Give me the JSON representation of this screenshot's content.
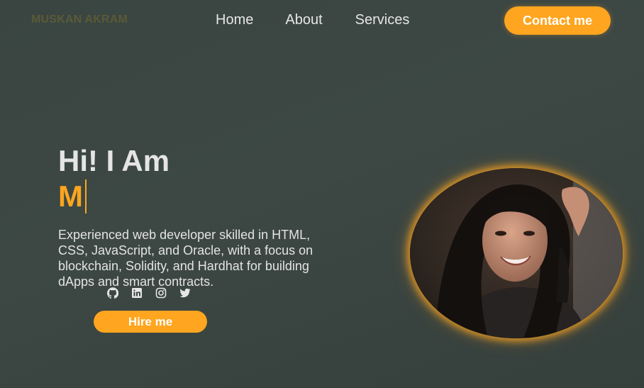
{
  "header": {
    "logo": "MUSKAN AKRAM",
    "nav": [
      {
        "label": "Home"
      },
      {
        "label": "About"
      },
      {
        "label": "Services"
      }
    ],
    "contact_label": "Contact me"
  },
  "hero": {
    "greeting": "Hi! I Am",
    "typed_text": "M",
    "description": "Experienced web developer skilled in HTML, CSS, JavaScript, and Oracle, with a focus on blockchain, Solidity, and Hardhat for building dApps and smart contracts.",
    "socials": [
      {
        "icon": "github-icon"
      },
      {
        "icon": "linkedin-icon"
      },
      {
        "icon": "instagram-icon"
      },
      {
        "icon": "twitter-icon"
      }
    ],
    "hire_label": "Hire me"
  },
  "colors": {
    "accent": "#ffa51f",
    "background": "#3b4642",
    "text": "#e5e5e5",
    "logo": "#5b5a37"
  }
}
